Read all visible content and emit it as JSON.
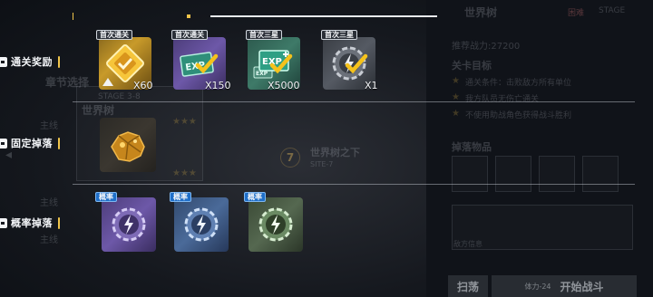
{
  "background": {
    "panel_title": "世界树",
    "difficulty_tag": "困难",
    "stage_prefix": "STAGE",
    "power_label": "推荐战力:27200",
    "goal_title": "关卡目标",
    "goals": [
      "通关条件：击败敌方所有单位",
      "我方队员无伤亡通关",
      "不使用助战角色获得战斗胜利"
    ],
    "drops_title": "掉落物品",
    "chapter_label": "章节选择",
    "stage_code": "STAGE 3-8",
    "stage_name": "世界树",
    "main_tag": "主线",
    "node_number": "7",
    "node_name": "世界树之下",
    "node_code": "SITE-7",
    "enemy_info": "敌方信息",
    "sweep_button": "扫荡",
    "start_button": "开始战斗",
    "cost_label": "体力-24"
  },
  "sections": {
    "clear_reward": {
      "label": "通关奖励",
      "items": [
        {
          "badge": "首次通关",
          "qty": "X60",
          "icon": "gold-diamond-ticket-icon"
        },
        {
          "badge": "首次通关",
          "qty": "X150",
          "icon": "exp-card-icon"
        },
        {
          "badge": "首次三星",
          "qty": "X5000",
          "icon": "exp-card-plus-icon"
        },
        {
          "badge": "首次三星",
          "qty": "X1",
          "icon": "gear-lightning-chip-icon"
        }
      ]
    },
    "fixed_drop": {
      "label": "固定掉落",
      "items": [
        {
          "badge": "",
          "qty": "",
          "icon": "gold-ore-icon"
        }
      ]
    },
    "chance_drop": {
      "label": "概率掉落",
      "items": [
        {
          "badge": "概率",
          "qty": "",
          "icon": "purple-gear-chip-icon"
        },
        {
          "badge": "概率",
          "qty": "",
          "icon": "blue-gear-chip-icon"
        },
        {
          "badge": "概率",
          "qty": "",
          "icon": "green-gear-chip-icon"
        }
      ]
    }
  },
  "colors": {
    "accent": "#f0c44a",
    "badge_blue": "#1f6fc9",
    "check_yellow": "#f5c21b"
  }
}
